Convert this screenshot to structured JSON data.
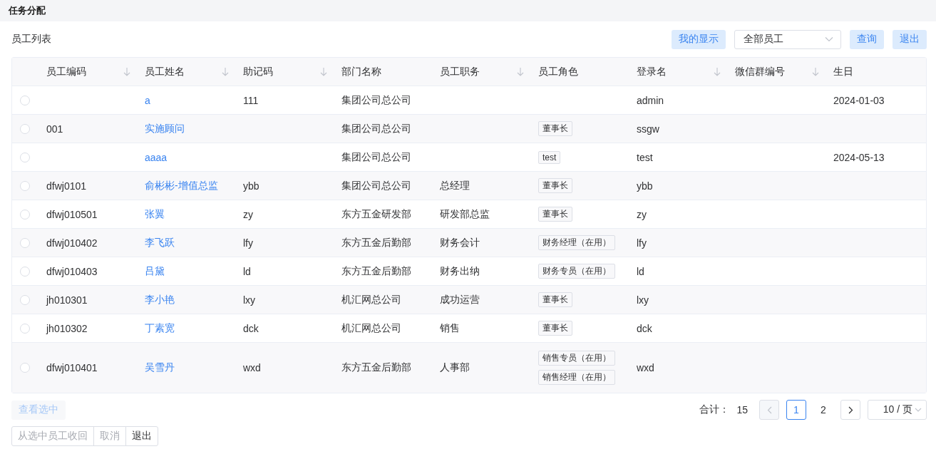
{
  "page_title": "任务分配",
  "list_title": "员工列表",
  "toolbar": {
    "my_display_button": "我的显示",
    "employee_filter": {
      "value": "全部员工"
    },
    "query_button": "查询",
    "exit_button": "退出"
  },
  "table": {
    "columns": [
      {
        "label": "员工编码",
        "sortable": true
      },
      {
        "label": "员工姓名",
        "sortable": true
      },
      {
        "label": "助记码",
        "sortable": true
      },
      {
        "label": "部门名称",
        "sortable": false
      },
      {
        "label": "员工职务",
        "sortable": true
      },
      {
        "label": "员工角色",
        "sortable": false
      },
      {
        "label": "登录名",
        "sortable": true
      },
      {
        "label": "微信群编号",
        "sortable": true
      },
      {
        "label": "生日",
        "sortable": false
      }
    ],
    "rows": [
      {
        "selected": false,
        "code": "",
        "name": "a",
        "mnemonic": "111",
        "department": "集团公司总公司",
        "position": "",
        "roles": [],
        "login": "admin",
        "wechat_group": "",
        "birthday": "2024-01-03"
      },
      {
        "selected": false,
        "code": "001",
        "name": "实施顾问",
        "mnemonic": "",
        "department": "集团公司总公司",
        "position": "",
        "roles": [
          "董事长"
        ],
        "login": "ssgw",
        "wechat_group": "",
        "birthday": ""
      },
      {
        "selected": false,
        "code": "",
        "name": "aaaa",
        "mnemonic": "",
        "department": "集团公司总公司",
        "position": "",
        "roles": [
          "test"
        ],
        "login": "test",
        "wechat_group": "",
        "birthday": "2024-05-13"
      },
      {
        "selected": false,
        "code": "dfwj0101",
        "name": "俞彬彬-增值总监",
        "mnemonic": "ybb",
        "department": "集团公司总公司",
        "position": "总经理",
        "roles": [
          "董事长"
        ],
        "login": "ybb",
        "wechat_group": "",
        "birthday": ""
      },
      {
        "selected": false,
        "code": "dfwj010501",
        "name": "张翼",
        "mnemonic": "zy",
        "department": "东方五金研发部",
        "position": "研发部总监",
        "roles": [
          "董事长"
        ],
        "login": "zy",
        "wechat_group": "",
        "birthday": ""
      },
      {
        "selected": false,
        "code": "dfwj010402",
        "name": "李飞跃",
        "mnemonic": "lfy",
        "department": "东方五金后勤部",
        "position": "财务会计",
        "roles": [
          "财务经理（在用）"
        ],
        "login": "lfy",
        "wechat_group": "",
        "birthday": ""
      },
      {
        "selected": false,
        "code": "dfwj010403",
        "name": "吕黛",
        "mnemonic": "ld",
        "department": "东方五金后勤部",
        "position": "财务出纳",
        "roles": [
          "财务专员（在用）"
        ],
        "login": "ld",
        "wechat_group": "",
        "birthday": ""
      },
      {
        "selected": false,
        "code": "jh010301",
        "name": "李小艳",
        "mnemonic": "lxy",
        "department": "机汇网总公司",
        "position": "成功运营",
        "roles": [
          "董事长"
        ],
        "login": "lxy",
        "wechat_group": "",
        "birthday": ""
      },
      {
        "selected": false,
        "code": "jh010302",
        "name": "丁素宽",
        "mnemonic": "dck",
        "department": "机汇网总公司",
        "position": "销售",
        "roles": [
          "董事长"
        ],
        "login": "dck",
        "wechat_group": "",
        "birthday": ""
      },
      {
        "selected": false,
        "code": "dfwj010401",
        "name": "吴雪丹",
        "mnemonic": "wxd",
        "department": "东方五金后勤部",
        "position": "人事部",
        "roles": [
          "销售专员（在用）",
          "销售经理（在用）"
        ],
        "login": "wxd",
        "wechat_group": "",
        "birthday": ""
      }
    ]
  },
  "view_selected_button": {
    "label": "查看选中",
    "disabled": true
  },
  "pagination": {
    "total_label": "合计：",
    "total": "15",
    "prev_disabled": true,
    "pages": [
      {
        "label": "1",
        "selected": true
      },
      {
        "label": "2",
        "selected": false
      }
    ],
    "next_disabled": false,
    "page_size": "10 / 页"
  },
  "footer_buttons": [
    {
      "label": "从选中员工收回",
      "disabled": true
    },
    {
      "label": "取消",
      "disabled": true
    },
    {
      "label": "退出",
      "disabled": false
    }
  ]
}
